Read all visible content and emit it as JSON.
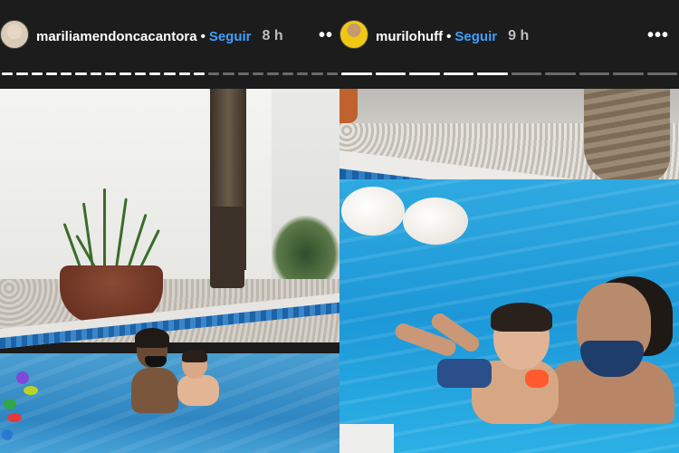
{
  "stories": [
    {
      "username": "mariliamendoncacantora",
      "separator": "•",
      "follow_label": "Seguir",
      "time": "8 h",
      "more_icon": "more-dots-icon",
      "progress": {
        "segments": 23,
        "completed": 14
      },
      "photo": "Mother and baby in a swimming pool near a white wall with a potted plant and palm trunk"
    },
    {
      "username": "murilohuff",
      "separator": "•",
      "follow_label": "Seguir",
      "time": "9 h",
      "more_icon": "more-dots-icon",
      "progress": {
        "segments": 10,
        "completed": 5
      },
      "photo": "Mother wearing a blue mask holding a baby in a blue swimming pool"
    }
  ],
  "colors": {
    "header_bg": "#1c1c1c",
    "follow_link": "#3fa0ff",
    "progress_done": "#f4f4f4",
    "progress_pending": "#6a6a6a"
  }
}
